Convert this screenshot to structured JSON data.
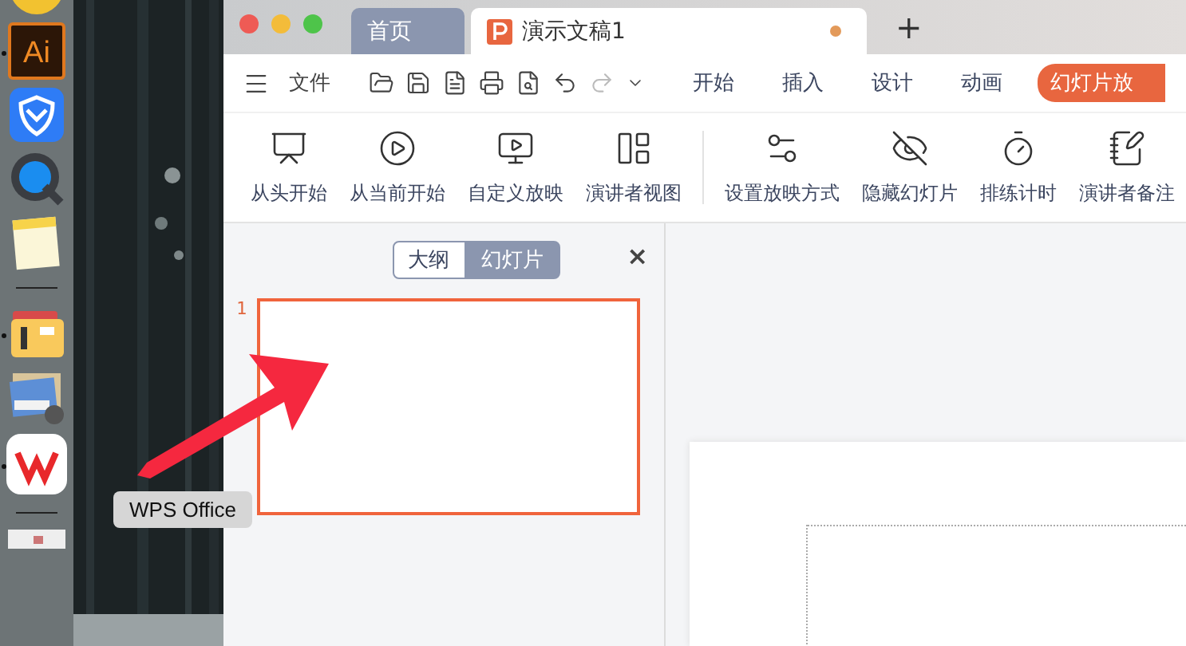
{
  "dock": {
    "items": [
      {
        "kind": "chrome",
        "running": false
      },
      {
        "kind": "illustrator",
        "label": "Ai",
        "running": true
      },
      {
        "kind": "shield",
        "running": false
      },
      {
        "kind": "quicktime",
        "running": false
      },
      {
        "kind": "notes",
        "running": false
      },
      {
        "kind": "divider"
      },
      {
        "kind": "archive",
        "running": true
      },
      {
        "kind": "preview",
        "running": false
      },
      {
        "kind": "wps",
        "running": true
      },
      {
        "kind": "divider"
      },
      {
        "kind": "thumbnail",
        "running": false
      }
    ],
    "tooltip": "WPS Office"
  },
  "window": {
    "tabs": [
      {
        "label": "首页",
        "selected": false,
        "kind": "home"
      },
      {
        "label": "演示文稿1",
        "selected": true,
        "kind": "document",
        "modified": true
      }
    ],
    "new_tab": "+"
  },
  "menu": {
    "file": "文件",
    "quick_actions": [
      {
        "disabled": false
      },
      {
        "disabled": false
      },
      {
        "disabled": false
      },
      {
        "disabled": false
      },
      {
        "disabled": false
      },
      {
        "disabled": false
      },
      {
        "disabled": true
      },
      {
        "disabled": false
      }
    ],
    "ribbon_tabs": [
      {
        "label": "开始",
        "selected": false
      },
      {
        "label": "插入",
        "selected": false
      },
      {
        "label": "设计",
        "selected": false
      },
      {
        "label": "动画",
        "selected": false
      },
      {
        "label": "幻灯片放",
        "selected": true
      }
    ]
  },
  "toolbar": {
    "groups": [
      [
        "从头开始",
        "从当前开始",
        "自定义放映",
        "演讲者视图"
      ],
      [
        "设置放映方式",
        "隐藏幻灯片",
        "排练计时",
        "演讲者备注"
      ]
    ]
  },
  "side_panel": {
    "views": [
      {
        "label": "大纲",
        "selected": false
      },
      {
        "label": "幻灯片",
        "selected": true
      }
    ],
    "close": "×",
    "slides": [
      {
        "number": "1",
        "selected": true
      }
    ]
  }
}
